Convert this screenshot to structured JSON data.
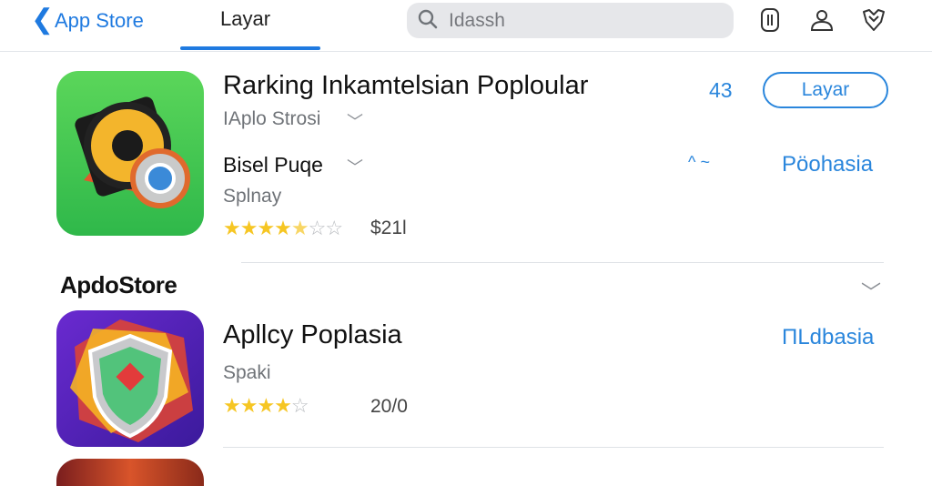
{
  "nav": {
    "back_label": "App Store",
    "tab_label": "Layar",
    "search_placeholder": "Idassh",
    "icons": [
      "phone-icon",
      "person-icon",
      "heart-icon"
    ]
  },
  "apps": [
    {
      "title": "Rarking Inkamtelsian Poploular",
      "developer": "IAplo Strosi",
      "detail": "Bisel Puqe",
      "category": "Splnay",
      "stars": "★★★★",
      "stars_half": "★",
      "stars_off": "☆☆",
      "rating_count": "$21l",
      "side_count": "43",
      "get_label": "Layar",
      "trend": "^ ~",
      "link": "Pöohasia"
    },
    {
      "title": "Apllcy Poplasia",
      "category": "Spaki",
      "stars": "★★★★",
      "stars_off": "☆",
      "rating_count": "20/0",
      "link": "ΠLdbasia"
    }
  ],
  "section": {
    "title": "ApdoStore"
  },
  "colors": {
    "accent": "#2a86dc",
    "star": "#f6c623",
    "search_bg": "#e6e7ea"
  }
}
